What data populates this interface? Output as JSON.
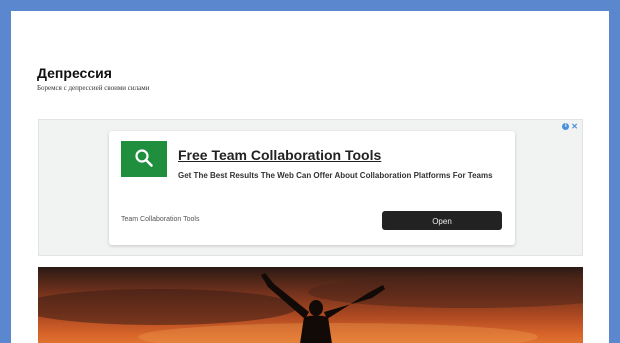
{
  "site": {
    "title": "Депрессия",
    "description": "Боремся с депрессией своими силами"
  },
  "ad": {
    "headline": "Free Team Collaboration Tools",
    "body": "Get The Best Results The Web Can Offer About Collaboration Platforms For Teams",
    "source": "Team Collaboration Tools",
    "cta_label": "Open",
    "icon": "search-icon",
    "icon_bg": "#1f8e3d",
    "info_icon": "info-icon",
    "close_icon": "close-icon"
  },
  "hero": {
    "image": "silhouette-raised-arms-sunset"
  },
  "colors": {
    "frame": "#5b87cf",
    "cta": "#222222"
  }
}
